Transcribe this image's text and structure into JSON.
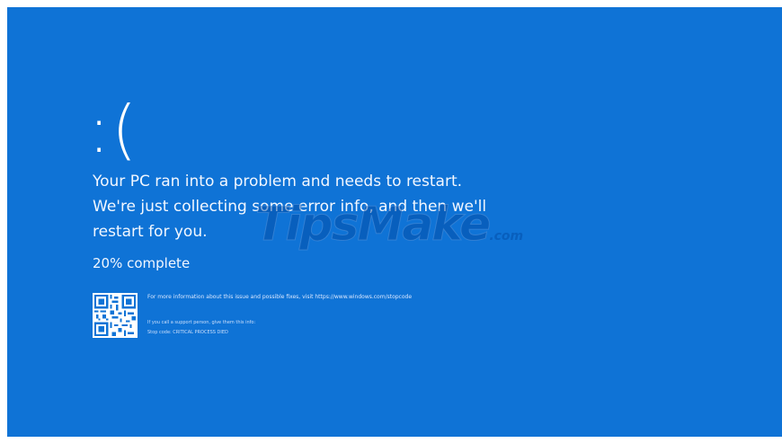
{
  "bsod": {
    "sad_face": ":(",
    "message": "Your PC ran into a problem and needs to restart. We're just collecting some error info, and then we'll restart for you.",
    "progress": "20% complete",
    "progress_percent": 20,
    "more_info": "For more information about this issue and possible fixes, visit https://www.windows.com/stopcode",
    "support": "If you call a support person, give them this info:",
    "stop_code": "Stop code: CRITICAL PROCESS DIED"
  },
  "watermark": {
    "brand": "TipsMake",
    "suffix": ".com"
  },
  "icons": {
    "qr": "qr-code-icon"
  },
  "colors": {
    "background": "#0f73d6",
    "text": "#ffffff"
  }
}
